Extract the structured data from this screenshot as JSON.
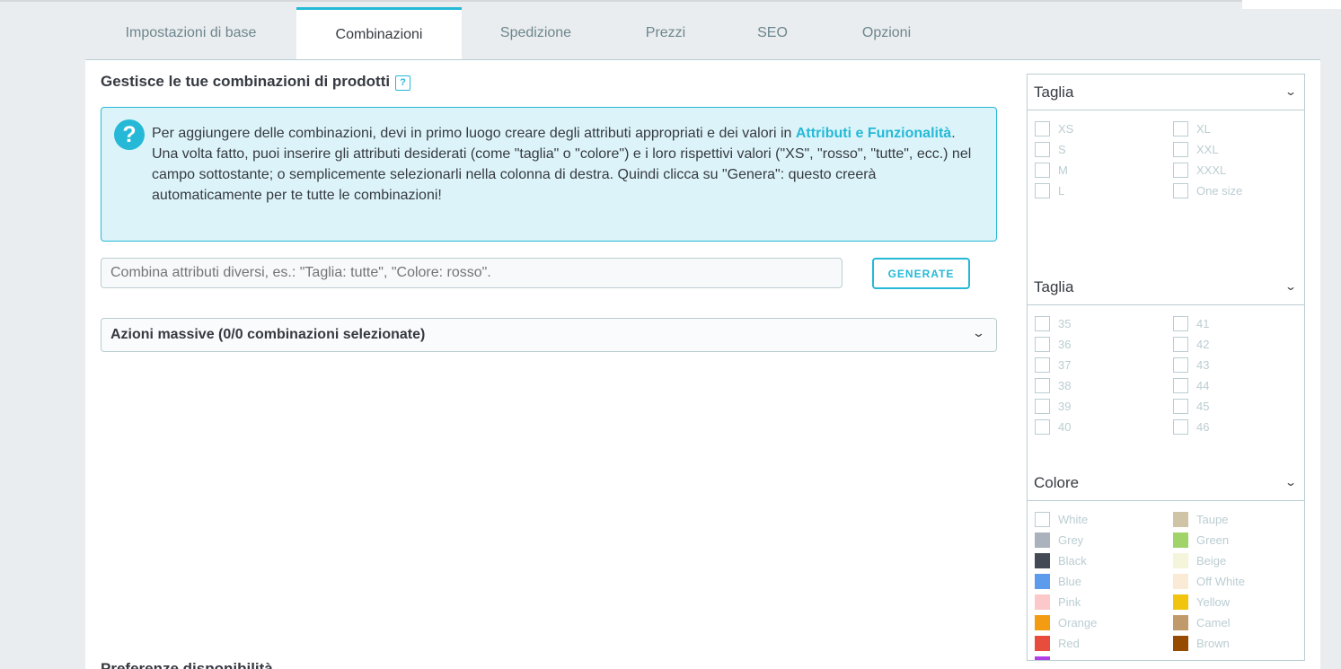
{
  "tabs": [
    {
      "label": "Impostazioni di base"
    },
    {
      "label": "Combinazioni"
    },
    {
      "label": "Spedizione"
    },
    {
      "label": "Prezzi"
    },
    {
      "label": "SEO"
    },
    {
      "label": "Opzioni"
    }
  ],
  "section": {
    "title": "Gestisce le tue combinazioni di prodotti",
    "help_badge": "?"
  },
  "alert": {
    "icon": "question-icon",
    "text_before": "Per aggiungere delle combinazioni, devi in primo luogo creare degli attributi appropriati e dei valori in ",
    "link": "Attributi e Funzionalità",
    "text_after": ".",
    "line2": "Una volta fatto, puoi inserire gli attributi desiderati (come \"taglia\" o \"colore\") e i loro rispettivi valori (\"XS\", \"rosso\", \"tutte\", ecc.) nel campo sottostante; o semplicemente selezionarli nella colonna di destra. Quindi clicca su \"Genera\": questo creerà automaticamente per te tutte le combinazioni!"
  },
  "combine": {
    "placeholder": "Combina attributi diversi, es.: \"Taglia: tutte\", \"Colore: rosso\".",
    "generate_label": "GENERATE"
  },
  "bulk": {
    "label": "Azioni massive (0/0 combinazioni selezionate)"
  },
  "bottom_heading": "Preferenze disponibilità",
  "attributes": [
    {
      "title": "Taglia",
      "values": [
        {
          "label": "XS"
        },
        {
          "label": "XL"
        },
        {
          "label": "S"
        },
        {
          "label": "XXL"
        },
        {
          "label": "M"
        },
        {
          "label": "XXXL"
        },
        {
          "label": "L"
        },
        {
          "label": "One size"
        }
      ]
    },
    {
      "title": "Taglia",
      "values": [
        {
          "label": "35"
        },
        {
          "label": "41"
        },
        {
          "label": "36"
        },
        {
          "label": "42"
        },
        {
          "label": "37"
        },
        {
          "label": "43"
        },
        {
          "label": "38"
        },
        {
          "label": "44"
        },
        {
          "label": "39"
        },
        {
          "label": "45"
        },
        {
          "label": "40"
        },
        {
          "label": "46"
        }
      ]
    },
    {
      "title": "Colore",
      "values": [
        {
          "label": "White",
          "color": "#ffffff"
        },
        {
          "label": "Taupe",
          "color": "#cfc4a6"
        },
        {
          "label": "Grey",
          "color": "#aab2bd"
        },
        {
          "label": "Green",
          "color": "#a0d468"
        },
        {
          "label": "Black",
          "color": "#434a54"
        },
        {
          "label": "Beige",
          "color": "#f5f5dc"
        },
        {
          "label": "Blue",
          "color": "#5d9cec"
        },
        {
          "label": "Off White",
          "color": "#faebd7"
        },
        {
          "label": "Pink",
          "color": "#fcc8ca"
        },
        {
          "label": "Yellow",
          "color": "#f1c40f"
        },
        {
          "label": "Orange",
          "color": "#f39c11"
        },
        {
          "label": "Camel",
          "color": "#c19a6b"
        },
        {
          "label": "Red",
          "color": "#e84c3d"
        },
        {
          "label": "Brown",
          "color": "#964b00"
        },
        {
          "label": "",
          "color": "#b13fe8"
        }
      ]
    }
  ]
}
